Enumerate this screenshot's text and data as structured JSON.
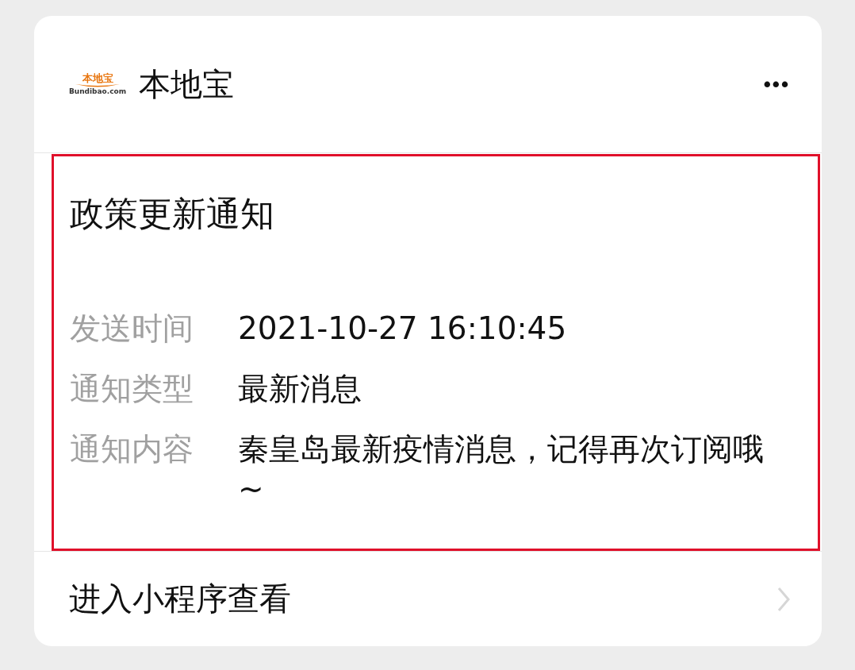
{
  "header": {
    "logo": {
      "name": "本地宝",
      "domain": "Bundibao.com"
    },
    "account_name": "本地宝",
    "more_button": "•••"
  },
  "message": {
    "title": "政策更新通知",
    "fields": [
      {
        "label": "发送时间",
        "value": "2021-10-27 16:10:45"
      },
      {
        "label": "通知类型",
        "value": "最新消息"
      },
      {
        "label": "通知内容",
        "value": "秦皇岛最新疫情消息，记得再次订阅哦~"
      }
    ]
  },
  "footer": {
    "link": "进入小程序查看"
  }
}
